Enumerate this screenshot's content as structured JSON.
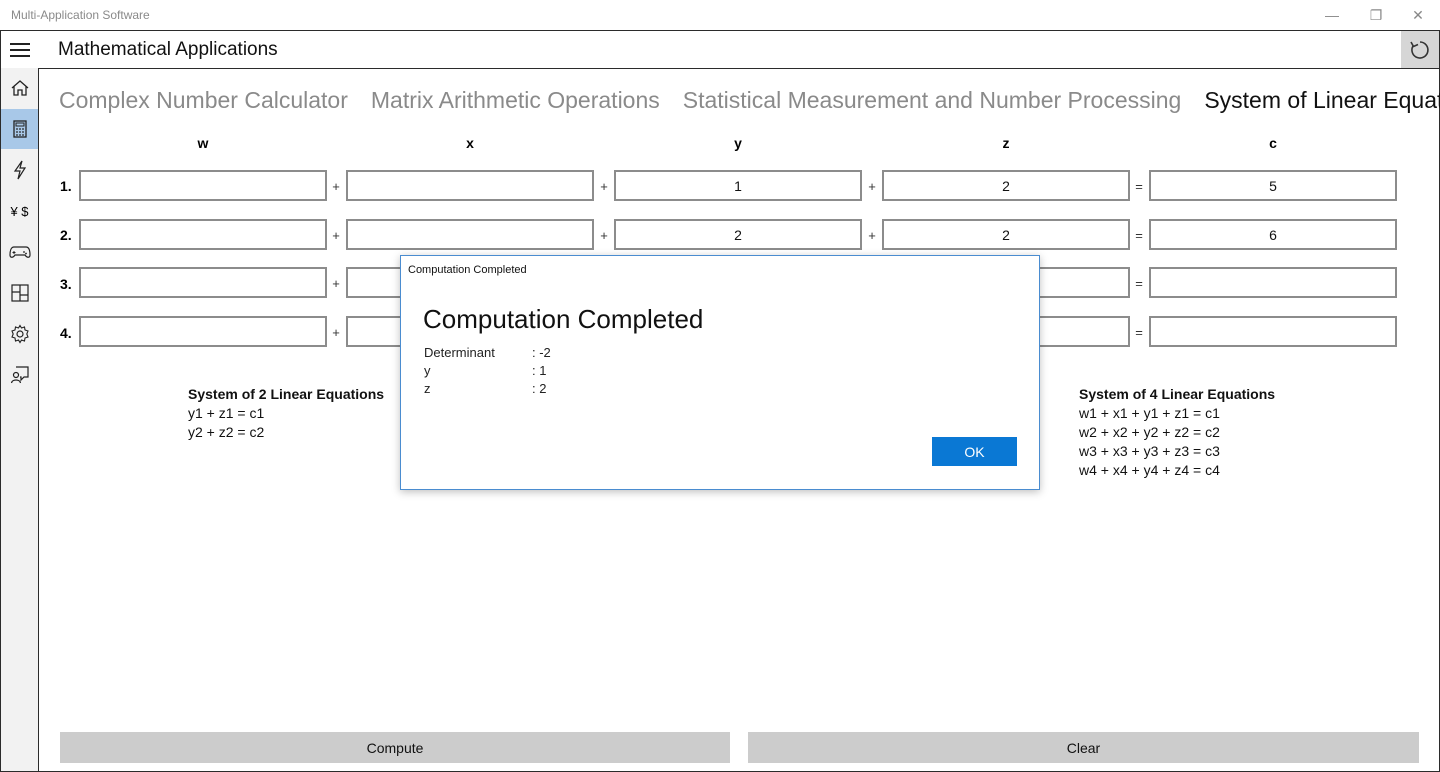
{
  "window": {
    "title": "Multi-Application Software",
    "minimize_glyph": "—",
    "restore_glyph": "❐",
    "close_glyph": "✕"
  },
  "appbar": {
    "title": "Mathematical Applications"
  },
  "sidebar": {
    "items": [
      {
        "icon": "home-icon"
      },
      {
        "icon": "calculator-icon",
        "active": true
      },
      {
        "icon": "lightning-icon"
      },
      {
        "icon": "currency-icon",
        "glyph": "¥ $"
      },
      {
        "icon": "gamepad-icon"
      },
      {
        "icon": "layout-icon"
      },
      {
        "icon": "gear-icon"
      },
      {
        "icon": "feedback-icon"
      }
    ]
  },
  "tabs": [
    {
      "label": "Complex Number Calculator",
      "selected": false
    },
    {
      "label": "Matrix Arithmetic Operations",
      "selected": false
    },
    {
      "label": "Statistical Measurement and Number Processing",
      "selected": false
    },
    {
      "label": "System of Linear Equations",
      "selected": true
    }
  ],
  "columns": [
    "w",
    "x",
    "y",
    "z",
    "c"
  ],
  "rows": [
    {
      "label": "1.",
      "w": "",
      "x": "",
      "y": "1",
      "z": "2",
      "c": "5"
    },
    {
      "label": "2.",
      "w": "",
      "x": "",
      "y": "2",
      "z": "2",
      "c": "6"
    },
    {
      "label": "3.",
      "w": "",
      "x": "",
      "y": "",
      "z": "",
      "c": ""
    },
    {
      "label": "4.",
      "w": "",
      "x": "",
      "y": "",
      "z": "",
      "c": ""
    }
  ],
  "operators": {
    "plus": "+",
    "equals": "="
  },
  "system2": {
    "header": "System of 2 Linear Equations",
    "lines": [
      "y1 + z1 = c1",
      "y2 + z2 = c2"
    ]
  },
  "system4": {
    "header": "System of 4 Linear Equations",
    "lines": [
      "w1 + x1 + y1 + z1 = c1",
      "w2 + x2 + y2 + z2 = c2",
      "w3 + x3 + y3 + z3 = c3",
      "w4 + x4 + y4 + z4 = c4"
    ]
  },
  "buttons": {
    "compute": "Compute",
    "clear": "Clear"
  },
  "dialog": {
    "caption": "Computation Completed",
    "title": "Computation Completed",
    "results": [
      {
        "key": "Determinant",
        "value": ": -2"
      },
      {
        "key": "y",
        "value": ": 1"
      },
      {
        "key": "z",
        "value": ": 2"
      }
    ],
    "ok_label": "OK"
  },
  "colors": {
    "accent": "#0A78D4",
    "active_nav": "#A8C8E8",
    "button_gray": "#CCCCCC"
  }
}
